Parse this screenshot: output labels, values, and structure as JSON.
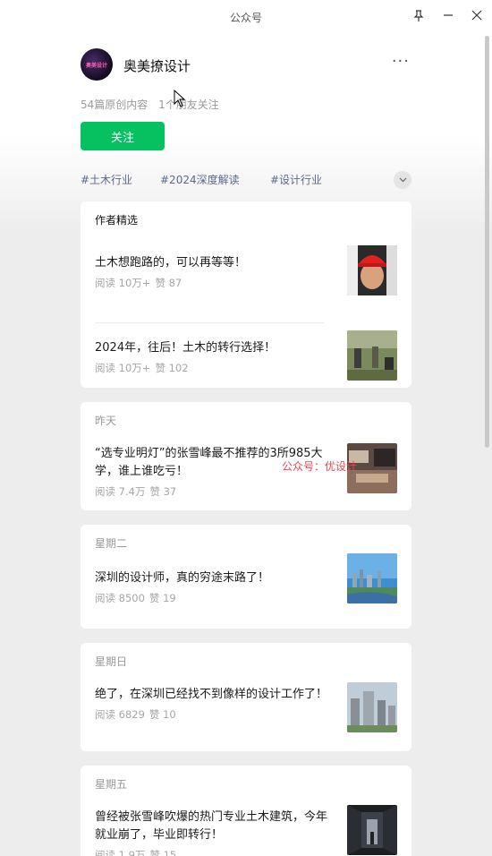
{
  "window": {
    "title": "公众号"
  },
  "profile": {
    "avatar_text": "奥美设计",
    "name": "奥美撩设计",
    "more": "···",
    "stats_articles": "54篇原创内容",
    "stats_friends": "1个朋友关注",
    "follow_label": "关注"
  },
  "tags": [
    "#土木行业",
    "#2024深度解读",
    "#设计行业"
  ],
  "featured": {
    "header": "作者精选",
    "articles": [
      {
        "title": "土木想跑路的，可以再等等！",
        "reads": "阅读 10万+",
        "likes": "赞 87"
      },
      {
        "title": "2024年，往后！土木的转行选择！",
        "reads": "阅读 10万+",
        "likes": "赞 102"
      }
    ]
  },
  "feed": [
    {
      "date": "昨天",
      "title": "“选专业明灯”的张雪峰最不推荐的3所985大学，谁上谁吃亏！",
      "reads": "阅读 7.4万",
      "likes": "赞 37"
    },
    {
      "date": "星期二",
      "title": "深圳的设计师，真的穷途末路了！",
      "reads": "阅读 8500",
      "likes": "赞 19"
    },
    {
      "date": "星期日",
      "title": "绝了，在深圳已经找不到像样的设计工作了！",
      "reads": "阅读 6829",
      "likes": "赞 10"
    },
    {
      "date": "星期五",
      "title": "曾经被张雪峰吹爆的热门专业土木建筑，今年就业崩了，毕业即转行！",
      "reads": "阅读 1.9万",
      "likes": "赞 15"
    }
  ],
  "watermark": "公众号：优设计",
  "icons": {
    "pin": "pin-icon",
    "minimize": "minimize-icon",
    "close": "close-icon",
    "more": "more-icon",
    "expand": "chevron-down-icon"
  },
  "colors": {
    "accent_green": "#07c160",
    "tag_blue": "#5a6a8a",
    "watermark_red": "#e8474f"
  }
}
